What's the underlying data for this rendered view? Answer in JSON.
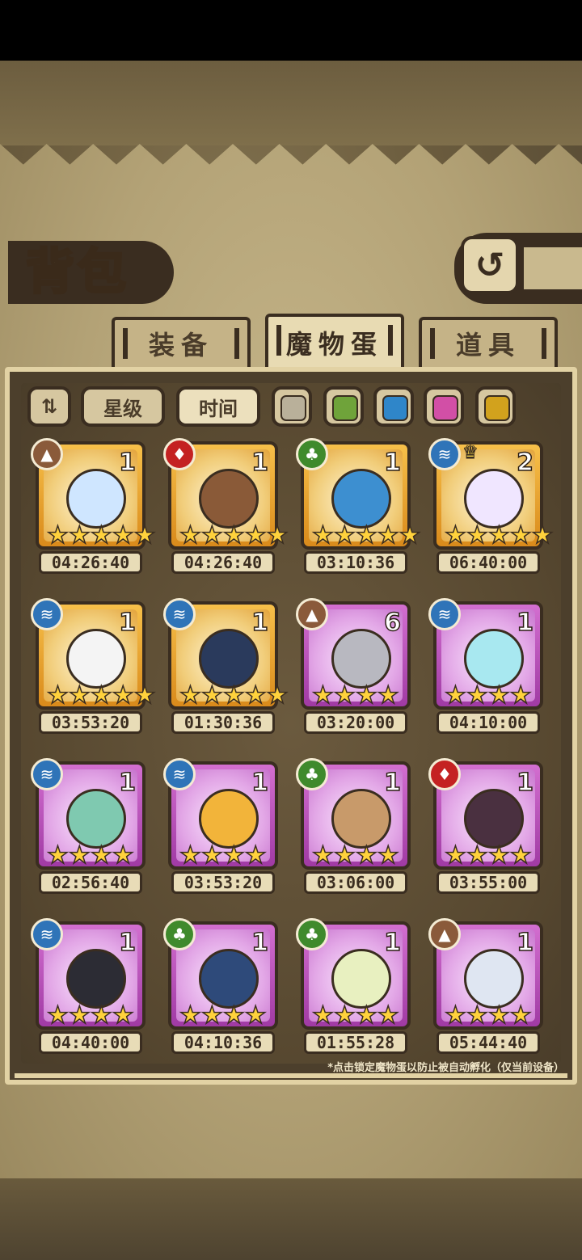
{
  "header": {
    "title": "背包",
    "back_icon": "back-arrow-icon"
  },
  "tabs": [
    {
      "label": "装备",
      "active": false
    },
    {
      "label": "魔物蛋",
      "active": true
    },
    {
      "label": "道具",
      "active": false
    }
  ],
  "filters": {
    "sort_icon": "sort-toggle-icon",
    "star_label": "星级",
    "time_label": "时间",
    "rarity_colors": [
      "#b9b09a",
      "#6fa33a",
      "#2f86c9",
      "#d24fa6",
      "#d2a21d"
    ]
  },
  "eggs": [
    {
      "element": "earth",
      "count": "1",
      "stars": 5,
      "rarity": "gold",
      "time": "04:26:40",
      "color": "#cfe6ff"
    },
    {
      "element": "fire",
      "count": "1",
      "stars": 5,
      "rarity": "gold",
      "time": "04:26:40",
      "color": "#8a5a38"
    },
    {
      "element": "leaf",
      "count": "1",
      "stars": 5,
      "rarity": "gold",
      "time": "03:10:36",
      "color": "#3d8fd0"
    },
    {
      "element": "water",
      "count": "2",
      "stars": 5,
      "rarity": "gold",
      "time": "06:40:00",
      "color": "#f0e6ff"
    },
    {
      "element": "water",
      "count": "1",
      "stars": 5,
      "rarity": "gold",
      "time": "03:53:20",
      "color": "#f4f4f4"
    },
    {
      "element": "water",
      "count": "1",
      "stars": 5,
      "rarity": "gold",
      "time": "01:30:36",
      "color": "#2a3a5c"
    },
    {
      "element": "earth",
      "count": "6",
      "stars": 4,
      "rarity": "purple",
      "time": "03:20:00",
      "color": "#b8b8c0"
    },
    {
      "element": "water",
      "count": "1",
      "stars": 4,
      "rarity": "purple",
      "time": "04:10:00",
      "color": "#a8e8f0"
    },
    {
      "element": "water",
      "count": "1",
      "stars": 4,
      "rarity": "purple",
      "time": "02:56:40",
      "color": "#7fc9b0"
    },
    {
      "element": "water",
      "count": "1",
      "stars": 4,
      "rarity": "purple",
      "time": "03:53:20",
      "color": "#f2b43a"
    },
    {
      "element": "leaf",
      "count": "1",
      "stars": 4,
      "rarity": "purple",
      "time": "03:06:00",
      "color": "#c89a6a"
    },
    {
      "element": "fire",
      "count": "1",
      "stars": 4,
      "rarity": "purple",
      "time": "03:55:00",
      "color": "#4a3040"
    },
    {
      "element": "water",
      "count": "1",
      "stars": 4,
      "rarity": "purple",
      "time": "04:40:00",
      "color": "#2c2c34"
    },
    {
      "element": "leaf",
      "count": "1",
      "stars": 4,
      "rarity": "purple",
      "time": "04:10:36",
      "color": "#2e4a7a"
    },
    {
      "element": "leaf",
      "count": "1",
      "stars": 4,
      "rarity": "purple",
      "time": "01:55:28",
      "color": "#e8f0c0"
    },
    {
      "element": "earth",
      "count": "1",
      "stars": 4,
      "rarity": "purple",
      "time": "05:44:40",
      "color": "#dfe6f2"
    }
  ],
  "footnote": "*点击锁定魔物蛋以防止被自动孵化（仅当前设备）"
}
